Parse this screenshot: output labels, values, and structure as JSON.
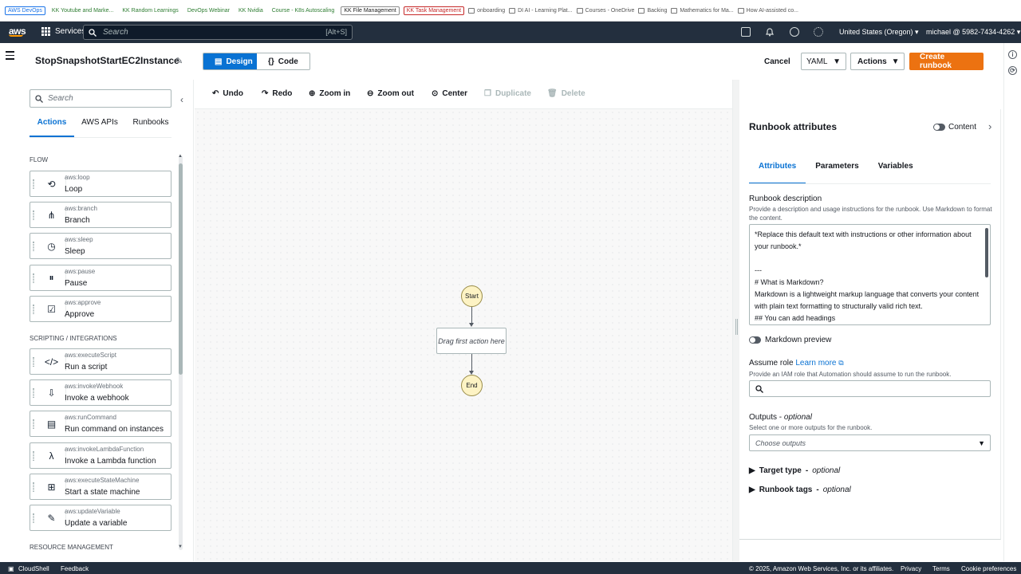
{
  "bookmarks": [
    "AWS DevOps",
    "KK Youtube and Marke...",
    "KK Random Learnings",
    "DevOps Webinar",
    "KK Nvidia",
    "Course - K8s Autoscaling",
    "KK File Management",
    "KK Task Management"
  ],
  "bookmark_folders": [
    "onboarding",
    "DI AI - Learning Plat...",
    "Courses - OneDrive",
    "Backing",
    "Mathematics for Ma...",
    "How AI-assisted co..."
  ],
  "nav": {
    "logo": "aws",
    "services": "Services",
    "search_placeholder": "Search",
    "search_shortcut": "[Alt+S]",
    "region": "United States (Oregon) ▾",
    "user": "michael @ 5982-7434-4262 ▾"
  },
  "header": {
    "title": "StopSnapshotStartEC2Instance",
    "design": "Design",
    "code": "Code",
    "cancel": "Cancel",
    "format": "YAML",
    "actions": "Actions",
    "create": "Create runbook"
  },
  "left": {
    "search_placeholder": "Search",
    "tabs": [
      "Actions",
      "AWS APIs",
      "Runbooks"
    ],
    "sections": {
      "flow": "FLOW",
      "scripting": "SCRIPTING / INTEGRATIONS",
      "resource": "RESOURCE MANAGEMENT"
    },
    "flow_items": [
      {
        "type": "aws:loop",
        "name": "Loop",
        "icon": "⟲"
      },
      {
        "type": "aws:branch",
        "name": "Branch",
        "icon": "⋔"
      },
      {
        "type": "aws:sleep",
        "name": "Sleep",
        "icon": "◷"
      },
      {
        "type": "aws:pause",
        "name": "Pause",
        "icon": "⏸"
      },
      {
        "type": "aws:approve",
        "name": "Approve",
        "icon": "☑"
      }
    ],
    "script_items": [
      {
        "type": "aws:executeScript",
        "name": "Run a script",
        "icon": "</>"
      },
      {
        "type": "aws:invokeWebhook",
        "name": "Invoke a webhook",
        "icon": "⇩"
      },
      {
        "type": "aws:runCommand",
        "name": "Run command on instances",
        "icon": "▤"
      },
      {
        "type": "aws:invokeLambdaFunction",
        "name": "Invoke a Lambda function",
        "icon": "λ"
      },
      {
        "type": "aws:executeStateMachine",
        "name": "Start a state machine",
        "icon": "⊞"
      },
      {
        "type": "aws:updateVariable",
        "name": "Update a variable",
        "icon": "✎"
      }
    ]
  },
  "toolbar": {
    "undo": "Undo",
    "redo": "Redo",
    "zoom_in": "Zoom in",
    "zoom_out": "Zoom out",
    "center": "Center",
    "duplicate": "Duplicate",
    "delete": "Delete"
  },
  "canvas": {
    "start": "Start",
    "drop": "Drag first action here",
    "end": "End"
  },
  "right": {
    "title": "Runbook attributes",
    "content_toggle": "Content",
    "tabs": [
      "Attributes",
      "Parameters",
      "Variables"
    ],
    "desc_label": "Runbook description",
    "desc_help": "Provide a description and usage instructions for the runbook. Use Markdown to format the content.",
    "desc_lines": [
      "*Replace this default text with instructions or other information about",
      "your runbook.*",
      "",
      "---",
      "# What is Markdown?",
      "Markdown is a lightweight markup language that converts your content",
      "with plain text formatting to structurally valid rich text.",
      "## You can add headings"
    ],
    "markdown_preview": "Markdown preview",
    "role_label": "Assume role",
    "learn_more": "Learn more",
    "role_help": "Provide an IAM role that Automation should assume to run the runbook.",
    "outputs_label": "Outputs",
    "optional": "optional",
    "outputs_help": "Select one or more outputs for the runbook.",
    "outputs_placeholder": "Choose outputs",
    "target_type": "Target type",
    "runbook_tags": "Runbook tags"
  },
  "footer": {
    "cloudshell": "CloudShell",
    "feedback": "Feedback",
    "copyright": "© 2025, Amazon Web Services, Inc. or its affiliates.",
    "privacy": "Privacy",
    "terms": "Terms",
    "cookies": "Cookie preferences"
  },
  "colors": {
    "nav": "#232f3e",
    "accent": "#0972d3",
    "create": "#ec7211",
    "node": "#fdf3c4"
  }
}
